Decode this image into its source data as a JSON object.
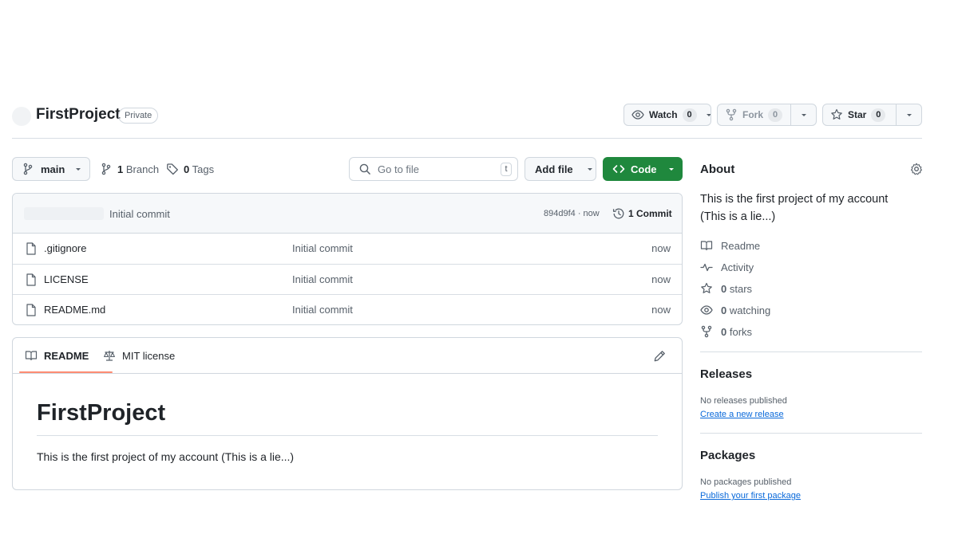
{
  "repo": {
    "name": "FirstProject",
    "visibility": "Private"
  },
  "actions": {
    "watch_label": "Watch",
    "watch_count": "0",
    "fork_label": "Fork",
    "fork_count": "0",
    "star_label": "Star",
    "star_count": "0"
  },
  "toolbar": {
    "branch": "main",
    "branches_count": "1",
    "branches_label": "Branch",
    "tags_count": "0",
    "tags_label": "Tags",
    "search_placeholder": "Go to file",
    "search_shortcut": "t",
    "add_file_label": "Add file",
    "code_label": "Code"
  },
  "latest_commit": {
    "message": "Initial commit",
    "hash_time": "894d9f4 · now",
    "commits_label": "1 Commit"
  },
  "files": [
    {
      "name": ".gitignore",
      "commit": "Initial commit",
      "time": "now"
    },
    {
      "name": "LICENSE",
      "commit": "Initial commit",
      "time": "now"
    },
    {
      "name": "README.md",
      "commit": "Initial commit",
      "time": "now"
    }
  ],
  "readme": {
    "tab_readme": "README",
    "tab_license": "MIT license",
    "heading": "FirstProject",
    "body": "This is the first project of my account (This is a lie...)"
  },
  "about": {
    "title": "About",
    "description": "This is the first project of my account (This is a lie...)",
    "readme_label": "Readme",
    "activity_label": "Activity",
    "stars_count": "0",
    "stars_label": "stars",
    "watching_count": "0",
    "watching_label": "watching",
    "forks_count": "0",
    "forks_label": "forks"
  },
  "releases": {
    "title": "Releases",
    "empty": "No releases published",
    "link": "Create a new release"
  },
  "packages": {
    "title": "Packages",
    "empty": "No packages published",
    "link": "Publish your first package"
  },
  "colors": {
    "accent_green": "#1f883d",
    "link_blue": "#0969da",
    "tab_underline": "#fd8c73"
  }
}
